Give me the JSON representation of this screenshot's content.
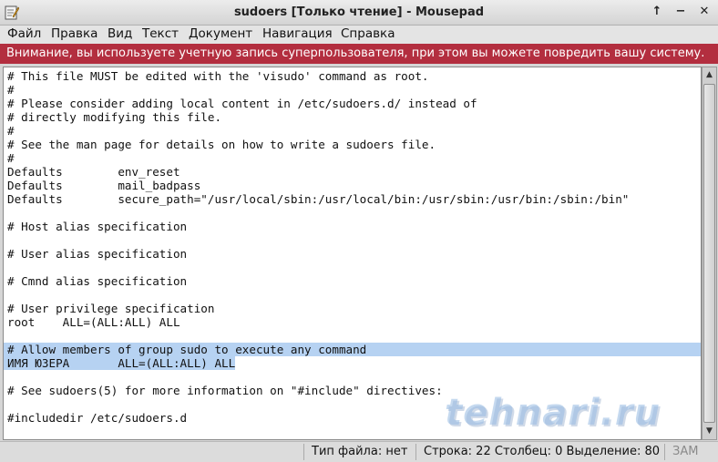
{
  "window": {
    "title": "sudoers [Только чтение] - Mousepad",
    "btn_up": "↑",
    "btn_min": "−",
    "btn_close": "✕"
  },
  "menu": {
    "file": "Файл",
    "edit": "Правка",
    "view": "Вид",
    "text": "Текст",
    "document": "Документ",
    "navigation": "Навигация",
    "help": "Справка"
  },
  "warning": "Внимание, вы используете учетную запись суперпользователя, при этом вы можете повредить вашу систему.",
  "editor": {
    "lines": [
      "# This file MUST be edited with the 'visudo' command as root.",
      "#",
      "# Please consider adding local content in /etc/sudoers.d/ instead of",
      "# directly modifying this file.",
      "#",
      "# See the man page for details on how to write a sudoers file.",
      "#",
      "Defaults        env_reset",
      "Defaults        mail_badpass",
      "Defaults        secure_path=\"/usr/local/sbin:/usr/local/bin:/usr/sbin:/usr/bin:/sbin:/bin\"",
      "",
      "# Host alias specification",
      "",
      "# User alias specification",
      "",
      "# Cmnd alias specification",
      "",
      "# User privilege specification",
      "root    ALL=(ALL:ALL) ALL",
      "",
      "# Allow members of group sudo to execute any command",
      "ИМЯ ЮЗЕРА       ALL=(ALL:ALL) ALL",
      "",
      "# See sudoers(5) for more information on \"#include\" directives:",
      "",
      "#includedir /etc/sudoers.d"
    ]
  },
  "status": {
    "filetype": "Тип файла: нет",
    "position": "Строка: 22 Столбец: 0 Выделение: 80",
    "mode": "ЗАМ"
  },
  "watermark": "tehnari.ru",
  "colors": {
    "warning_bg": "#b32e3f",
    "selection": "#b6d2f2"
  }
}
